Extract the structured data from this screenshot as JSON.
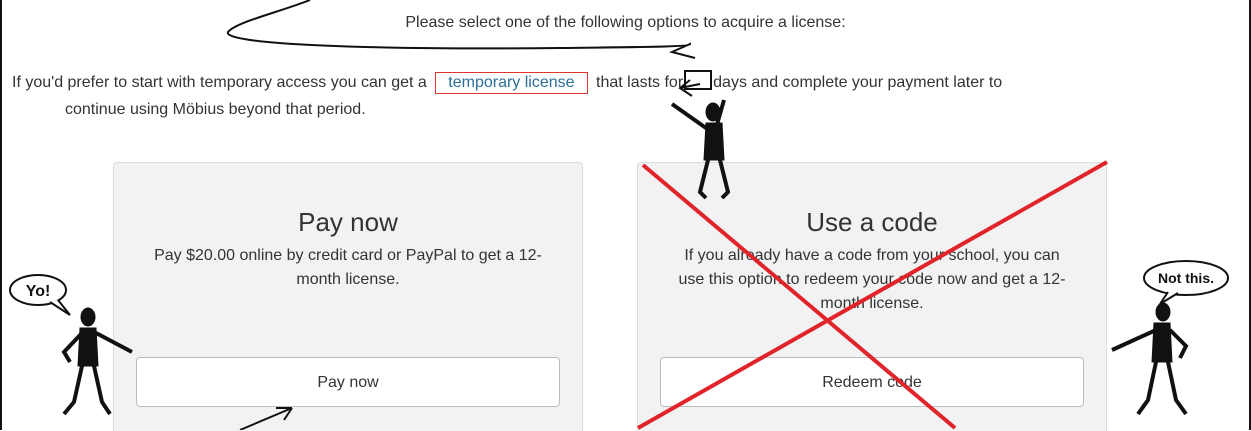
{
  "intro": {
    "text": "Please select one of the following options to acquire a license:"
  },
  "temporary": {
    "text_before": "If you'd prefer to start with temporary access you can get a",
    "link_label": "temporary license",
    "text_middle": "that lasts for",
    "text_after": "days and complete your payment later to",
    "text_line2": "continue using Möbius beyond that period."
  },
  "cards": {
    "pay": {
      "title": "Pay now",
      "description": "Pay $20.00 online by credit card or PayPal to get a 12-month license.",
      "button_label": "Pay now"
    },
    "code": {
      "title": "Use a code",
      "description": "If you already have a code from your school, you can use this option to redeem your code now and get a 12-month license.",
      "button_label": "Redeem code"
    }
  },
  "annotations": {
    "left_bubble": "Yo!",
    "right_bubble": "Not this.",
    "cross_color": "#e0242a",
    "highlight_color": "#e0342f",
    "link_color": "#2a6f97"
  }
}
